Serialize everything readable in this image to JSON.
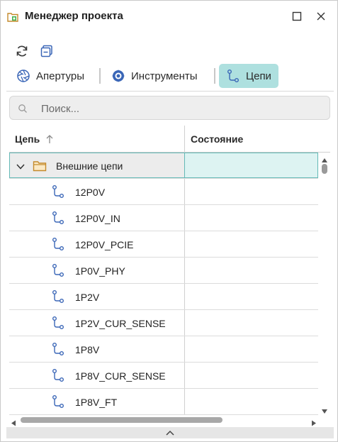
{
  "window": {
    "title": "Менеджер проекта"
  },
  "tabs": [
    {
      "label": "Апертуры",
      "icon": "aperture-icon",
      "active": false
    },
    {
      "label": "Инструменты",
      "icon": "drill-tool-icon",
      "active": false
    },
    {
      "label": "Цепи",
      "icon": "net-icon",
      "active": true
    }
  ],
  "search": {
    "placeholder": "Поиск...",
    "value": ""
  },
  "table": {
    "columns": [
      "Цепь",
      "Состояние"
    ],
    "sort": "ascending",
    "group": {
      "label": "Внешние цепи",
      "expanded": true
    },
    "rows": [
      {
        "name": "12P0V",
        "state": ""
      },
      {
        "name": "12P0V_IN",
        "state": ""
      },
      {
        "name": "12P0V_PCIE",
        "state": ""
      },
      {
        "name": "1P0V_PHY",
        "state": ""
      },
      {
        "name": "1P2V",
        "state": ""
      },
      {
        "name": "1P2V_CUR_SENSE",
        "state": ""
      },
      {
        "name": "1P8V",
        "state": ""
      },
      {
        "name": "1P8V_CUR_SENSE",
        "state": ""
      },
      {
        "name": "1P8V_FT",
        "state": ""
      }
    ]
  },
  "colors": {
    "accent": "#aee0df",
    "selection_border": "#63b9b6",
    "icon_blue": "#3a66b7",
    "folder": "#d9a54a"
  }
}
